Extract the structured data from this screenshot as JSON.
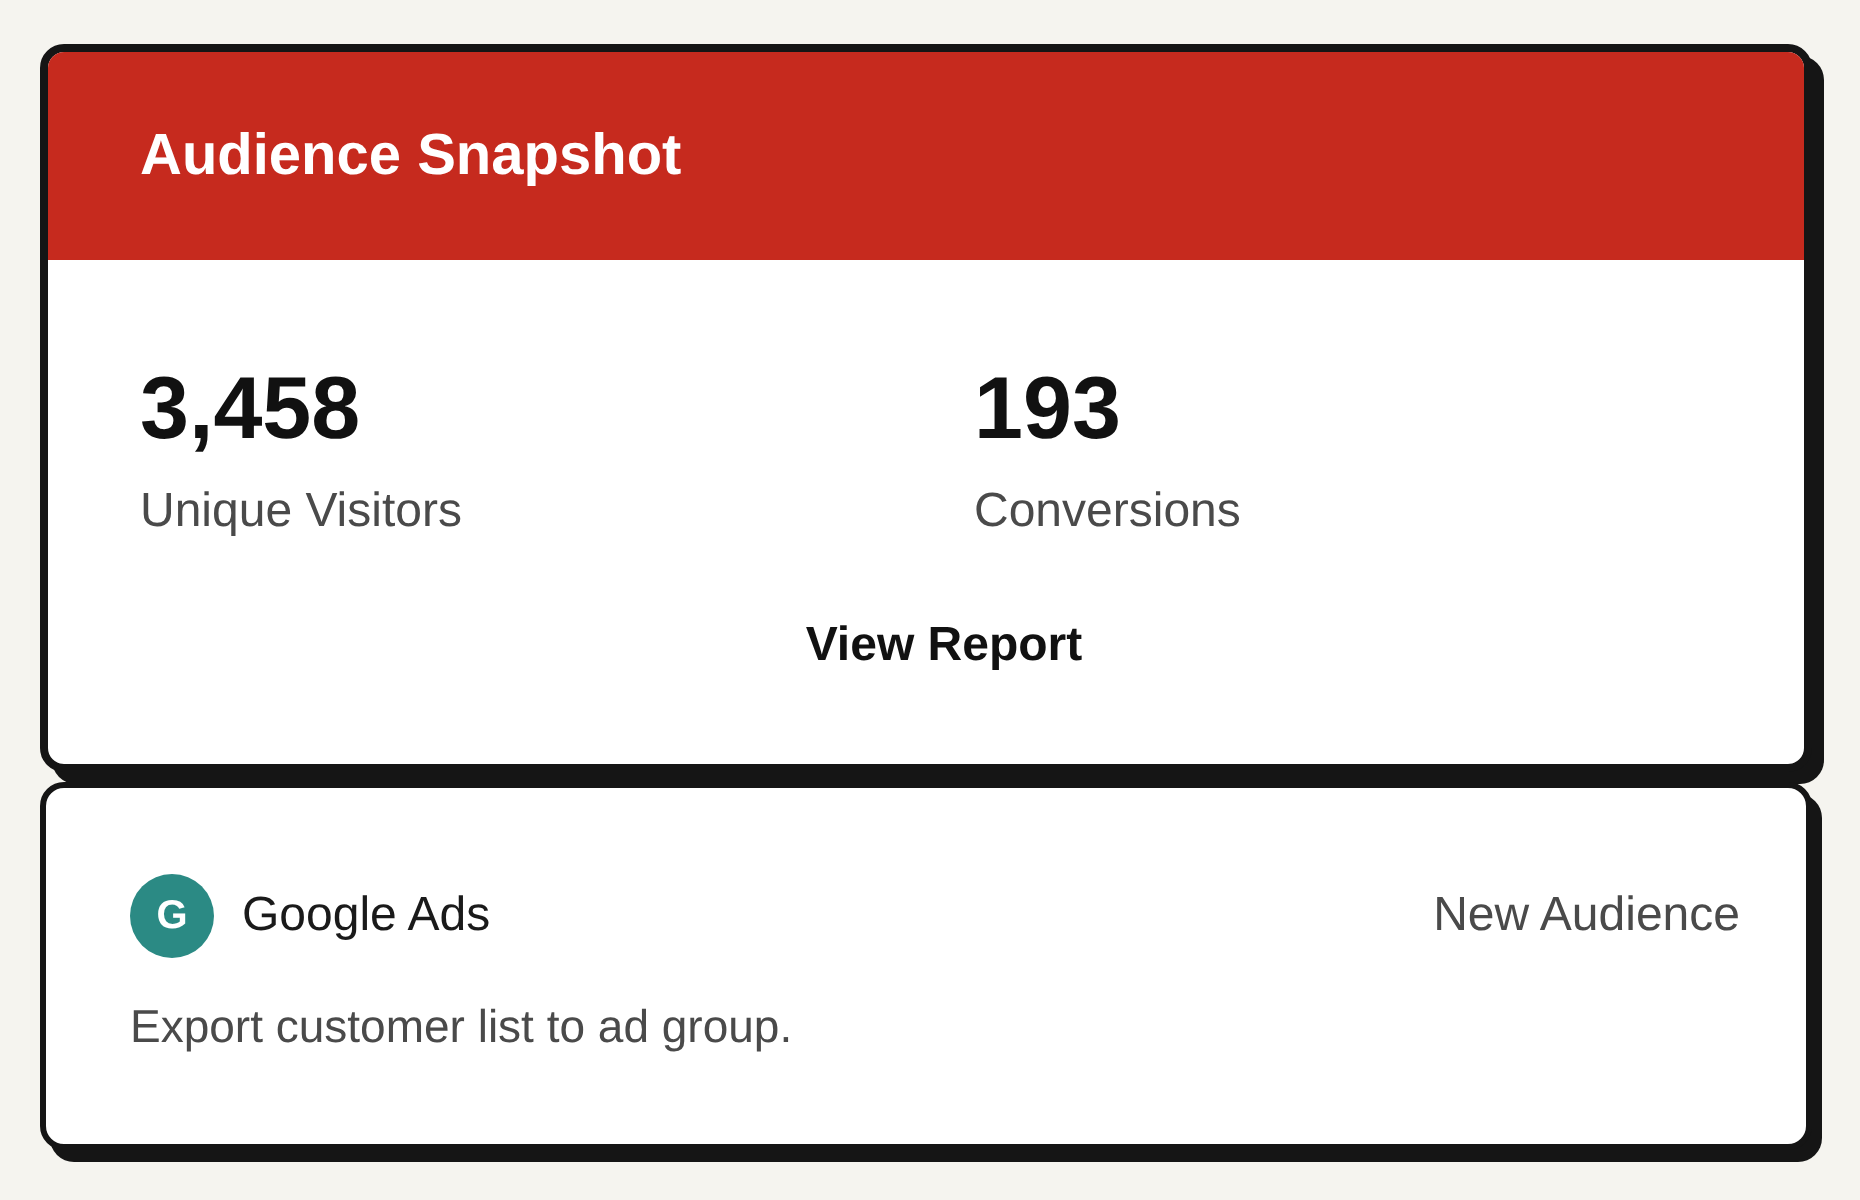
{
  "snapshot": {
    "title": "Audience Snapshot",
    "stats": [
      {
        "value": "3,458",
        "label": "Unique Visitors"
      },
      {
        "value": "193",
        "label": "Conversions"
      }
    ],
    "action": "View Report"
  },
  "integration": {
    "logo_letter": "G",
    "name": "Google Ads",
    "tag": "New Audience",
    "description": "Export customer list to ad group."
  }
}
